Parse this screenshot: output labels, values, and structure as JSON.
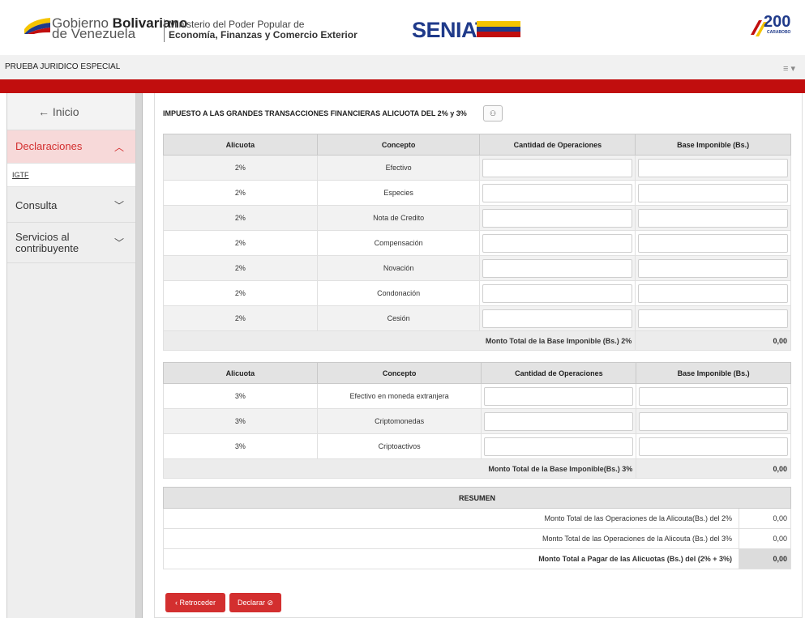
{
  "header": {
    "gobierno_line1_normal": "Gobierno ",
    "gobierno_line1_bold": "Bolivariano",
    "gobierno_line2": "de Venezuela",
    "ministerio_line1": "Ministerio del Poder Popular de",
    "ministerio_line2": "Economía, Finanzas y Comercio Exterior",
    "seniat_logo": "SENIAT",
    "bicentenario_num": "200",
    "bicentenario_sub": "CARABOBO"
  },
  "userbar": {
    "username": "PRUEBA JURIDICO ESPECIAL",
    "menu_icon": "≡ ▾"
  },
  "sidebar": {
    "back_label": "← Inicio",
    "declaraciones_label": "Declaraciones",
    "declaraciones_chevron": "︿",
    "igtf_label": "IGTF",
    "consulta_label": "Consulta",
    "consulta_chevron": "﹀",
    "servicios_label": "Servicios al contribuyente",
    "servicios_chevron": "﹀"
  },
  "main": {
    "title": "IMPUESTO A LAS GRANDES TRANSACCIONES FINANCIERAS ALICUOTA DEL 2% y 3%",
    "title_icon": "⚇",
    "table1": {
      "headers": [
        "Alicuota",
        "Concepto",
        "Cantidad de Operaciones",
        "Base Imponible (Bs.)"
      ],
      "rows": [
        {
          "alicuota": "2%",
          "concepto": "Efectivo"
        },
        {
          "alicuota": "2%",
          "concepto": "Especies"
        },
        {
          "alicuota": "2%",
          "concepto": "Nota de Credito"
        },
        {
          "alicuota": "2%",
          "concepto": "Compensación"
        },
        {
          "alicuota": "2%",
          "concepto": "Novación"
        },
        {
          "alicuota": "2%",
          "concepto": "Condonación"
        },
        {
          "alicuota": "2%",
          "concepto": "Cesión"
        }
      ],
      "total_label": "Monto Total de la Base Imponible (Bs.) 2%",
      "total_value": "0,00"
    },
    "table2": {
      "headers": [
        "Alicuota",
        "Concepto",
        "Cantidad de Operaciones",
        "Base Imponible (Bs.)"
      ],
      "rows": [
        {
          "alicuota": "3%",
          "concepto": "Efectivo en moneda extranjera"
        },
        {
          "alicuota": "3%",
          "concepto": "Criptomonedas"
        },
        {
          "alicuota": "3%",
          "concepto": "Criptoactivos"
        }
      ],
      "total_label": "Monto Total de la Base Imponible(Bs.) 3%",
      "total_value": "0,00"
    },
    "resumen": {
      "header": "RESUMEN",
      "row1_label": "Monto Total de las Operaciones de la Alicouta(Bs.) del 2%",
      "row1_value": "0,00",
      "row2_label": "Monto Total de las Operaciones de la Alicouta (Bs.) del 3%",
      "row2_value": "0,00",
      "row3_label": "Monto Total a Pagar de las Alicuotas (Bs.) del (2% + 3%)",
      "row3_value": "0,00"
    },
    "buttons": {
      "back": "‹ Retroceder",
      "declare": "Declarar ⊘"
    }
  },
  "colors": {
    "accent_red": "#c10e0e",
    "button_red": "#d32f2f",
    "seniat_blue": "#1f3a8a"
  }
}
